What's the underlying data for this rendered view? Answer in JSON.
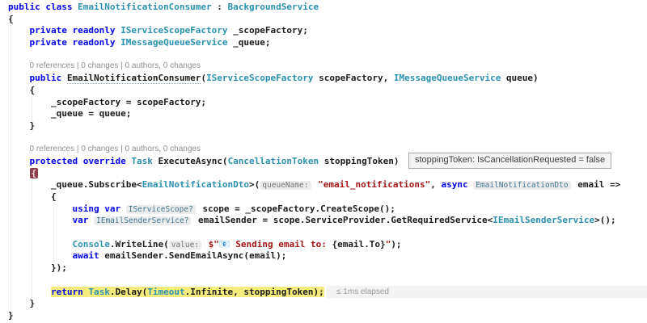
{
  "editor": {
    "language": "csharp",
    "colors": {
      "background": "#ffffff",
      "keyword": "#0000e8",
      "type": "#2b91af",
      "string": "#a31515",
      "plain": "#1b1b1b",
      "codelens": "#8f8f8f",
      "inline_hint_bg": "#ececec",
      "debug_brace_bg": "#8e3e4d",
      "current_statement_bg": "#f5ec7d"
    },
    "lines": [
      {
        "indent": 0,
        "tokens": [
          {
            "c": "kw",
            "x": "public class "
          },
          {
            "c": "ty",
            "x": "EmailNotificationConsumer"
          },
          {
            "c": "pl",
            "x": " : "
          },
          {
            "c": "ty",
            "x": "BackgroundService"
          }
        ]
      },
      {
        "indent": 0,
        "tokens": [
          {
            "c": "pl",
            "x": "{"
          }
        ]
      },
      {
        "indent": 1,
        "tokens": [
          {
            "c": "kw",
            "x": "private readonly "
          },
          {
            "c": "ty",
            "x": "IServiceScopeFactory"
          },
          {
            "c": "pl",
            "x": " _scopeFactory;"
          }
        ]
      },
      {
        "indent": 1,
        "tokens": [
          {
            "c": "kw",
            "x": "private readonly "
          },
          {
            "c": "ty",
            "x": "IMessageQueueService"
          },
          {
            "c": "pl",
            "x": " _queue;"
          }
        ]
      },
      {
        "indent": 0,
        "type": "blank",
        "tokens": []
      },
      {
        "indent": 1,
        "type": "lens",
        "tokens": [
          {
            "c": "lens",
            "x": "0 references | 0 changes | 0 authors, 0 changes"
          }
        ]
      },
      {
        "indent": 1,
        "tokens": [
          {
            "c": "kw",
            "x": "public "
          },
          {
            "c": "ctor",
            "x": "EmailNotificationConsumer"
          },
          {
            "c": "pl",
            "x": "("
          },
          {
            "c": "ty",
            "x": "IServiceScopeFactory"
          },
          {
            "c": "pl",
            "x": " scopeFactory, "
          },
          {
            "c": "ty",
            "x": "IMessageQueueService"
          },
          {
            "c": "pl",
            "x": " queue)"
          }
        ]
      },
      {
        "indent": 1,
        "tokens": [
          {
            "c": "pl",
            "x": "{"
          }
        ]
      },
      {
        "indent": 2,
        "tokens": [
          {
            "c": "pl",
            "x": "_scopeFactory = scopeFactory;"
          }
        ]
      },
      {
        "indent": 2,
        "tokens": [
          {
            "c": "pl",
            "x": "_queue = queue;"
          }
        ]
      },
      {
        "indent": 1,
        "tokens": [
          {
            "c": "pl",
            "x": "}"
          }
        ]
      },
      {
        "indent": 0,
        "type": "blank",
        "tokens": []
      },
      {
        "indent": 1,
        "type": "lens",
        "tokens": [
          {
            "c": "lens",
            "x": "0 references | 0 changes | 0 authors, 0 changes"
          }
        ]
      },
      {
        "indent": 1,
        "tokens": [
          {
            "c": "kw",
            "x": "protected override "
          },
          {
            "c": "ty",
            "x": "Task"
          },
          {
            "c": "pl",
            "x": " ExecuteAsync("
          },
          {
            "c": "ty",
            "x": "CancellationToken"
          },
          {
            "c": "pl",
            "x": " stoppingToken)"
          }
        ]
      },
      {
        "indent": 1,
        "tokens": [
          {
            "c": "dbg",
            "x": "{",
            "n": "debug-highlighted-brace"
          }
        ]
      },
      {
        "indent": 2,
        "tokens": [
          {
            "c": "pl",
            "x": "_queue.Subscribe<"
          },
          {
            "c": "ty",
            "x": "EmailNotificationDto"
          },
          {
            "c": "pl",
            "x": ">("
          },
          {
            "c": "hint",
            "x": "queueName:",
            "n": "inline-parameter-hint"
          },
          {
            "c": "pl",
            "x": " "
          },
          {
            "c": "str",
            "x": "\"email_notifications\""
          },
          {
            "c": "pl",
            "x": ", "
          },
          {
            "c": "kw",
            "x": "async "
          },
          {
            "c": "hintty",
            "x": "EmailNotificationDto",
            "n": "inline-type-hint"
          },
          {
            "c": "pl",
            "x": " email =>"
          }
        ]
      },
      {
        "indent": 2,
        "tokens": [
          {
            "c": "pl",
            "x": "{"
          }
        ]
      },
      {
        "indent": 3,
        "tokens": [
          {
            "c": "kw",
            "x": "using var "
          },
          {
            "c": "hintty",
            "x": "IServiceScope?",
            "n": "inline-type-hint"
          },
          {
            "c": "pl",
            "x": " scope = _scopeFactory.CreateScope();"
          }
        ]
      },
      {
        "indent": 3,
        "tokens": [
          {
            "c": "kw",
            "x": "var "
          },
          {
            "c": "hintty",
            "x": "IEmailSenderService?",
            "n": "inline-type-hint"
          },
          {
            "c": "pl",
            "x": " emailSender = scope.ServiceProvider.GetRequiredService<"
          },
          {
            "c": "ty",
            "x": "IEmailSenderService"
          },
          {
            "c": "pl",
            "x": ">();"
          }
        ]
      },
      {
        "indent": 0,
        "type": "blank",
        "tokens": []
      },
      {
        "indent": 3,
        "tokens": [
          {
            "c": "ty",
            "x": "Console"
          },
          {
            "c": "pl",
            "x": ".WriteLine("
          },
          {
            "c": "hint",
            "x": "value:",
            "n": "inline-parameter-hint"
          },
          {
            "c": "pl",
            "x": " "
          },
          {
            "c": "str",
            "x": "$\"📧 Sending email to: "
          },
          {
            "c": "pl",
            "x": "{email.To}"
          },
          {
            "c": "str",
            "x": "\""
          },
          {
            "c": "pl",
            "x": ");"
          }
        ]
      },
      {
        "indent": 3,
        "tokens": [
          {
            "c": "kw",
            "x": "await"
          },
          {
            "c": "pl",
            "x": " emailSender.SendEmailAsync(email);"
          }
        ]
      },
      {
        "indent": 2,
        "tokens": [
          {
            "c": "pl",
            "x": "});"
          }
        ]
      },
      {
        "indent": 0,
        "type": "blank",
        "tokens": []
      },
      {
        "indent": 2,
        "highlight": true,
        "tokens": [
          {
            "c": "kw",
            "x": "return "
          },
          {
            "c": "ty",
            "x": "Task"
          },
          {
            "c": "pl",
            "x": ".Delay("
          },
          {
            "c": "ty",
            "x": "Timeout"
          },
          {
            "c": "pl",
            "x": ".Infinite, stoppingToken);"
          }
        ]
      },
      {
        "indent": 1,
        "tokens": [
          {
            "c": "pl",
            "x": "}"
          }
        ]
      },
      {
        "indent": 0,
        "tokens": [
          {
            "c": "pl",
            "x": "}"
          }
        ]
      }
    ]
  },
  "tooltip": {
    "text": "stoppingToken: IsCancellationRequested = false"
  },
  "perf_tip": {
    "text": "≤ 1ms elapsed"
  }
}
